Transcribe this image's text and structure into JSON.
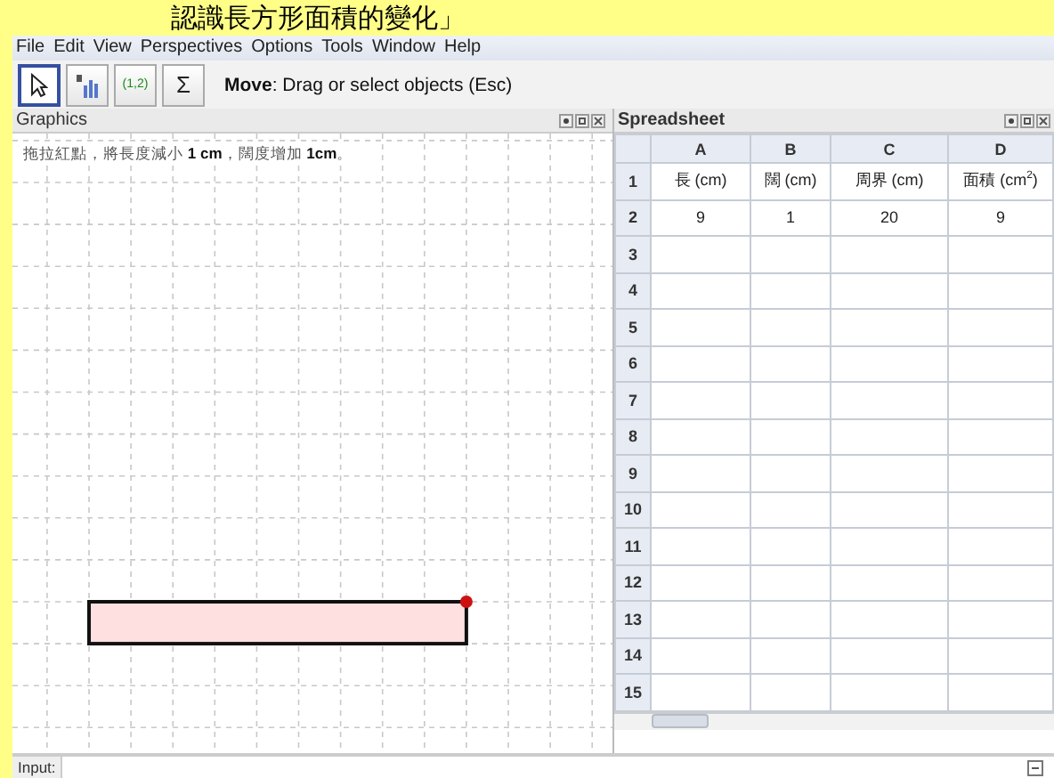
{
  "banner": {
    "title": "認識長方形面積的變化」"
  },
  "menu": [
    "File",
    "Edit",
    "View",
    "Perspectives",
    "Options",
    "Tools",
    "Window",
    "Help"
  ],
  "toolbar": {
    "tools": [
      {
        "kind": "move",
        "selected": true
      },
      {
        "kind": "chart",
        "selected": false
      },
      {
        "kind": "list",
        "label": "(1,2)",
        "selected": false
      },
      {
        "kind": "sum",
        "label": "Σ",
        "selected": false
      }
    ],
    "hint": "**Move**: Drag or select objects (Esc)"
  },
  "graphics": {
    "title": "Graphics",
    "note": "拖拉紅點，將長度減小 **1 cm**，闊度增加 **1cm**。"
  },
  "spreadsheet": {
    "title": "Spreadsheet",
    "columns": [
      "A",
      "B",
      "C",
      "D"
    ],
    "rows": [
      {
        "header": "1",
        "cells": [
          "長 (cm)",
          "闊 (cm)",
          "周界 (cm)",
          "面積 (cm$^{2}$)"
        ]
      },
      {
        "header": "2",
        "cells": [
          "9",
          "1",
          "20",
          "9"
        ]
      },
      {
        "header": "3"
      },
      {
        "header": "4"
      },
      {
        "header": "5"
      },
      {
        "header": "6"
      },
      {
        "header": "7"
      },
      {
        "header": "8"
      },
      {
        "header": "9"
      },
      {
        "header": "10"
      },
      {
        "header": "11"
      },
      {
        "header": "12"
      },
      {
        "header": "13"
      },
      {
        "header": "14"
      },
      {
        "header": "15"
      }
    ]
  },
  "input_bar": {
    "label": "Input:"
  }
}
